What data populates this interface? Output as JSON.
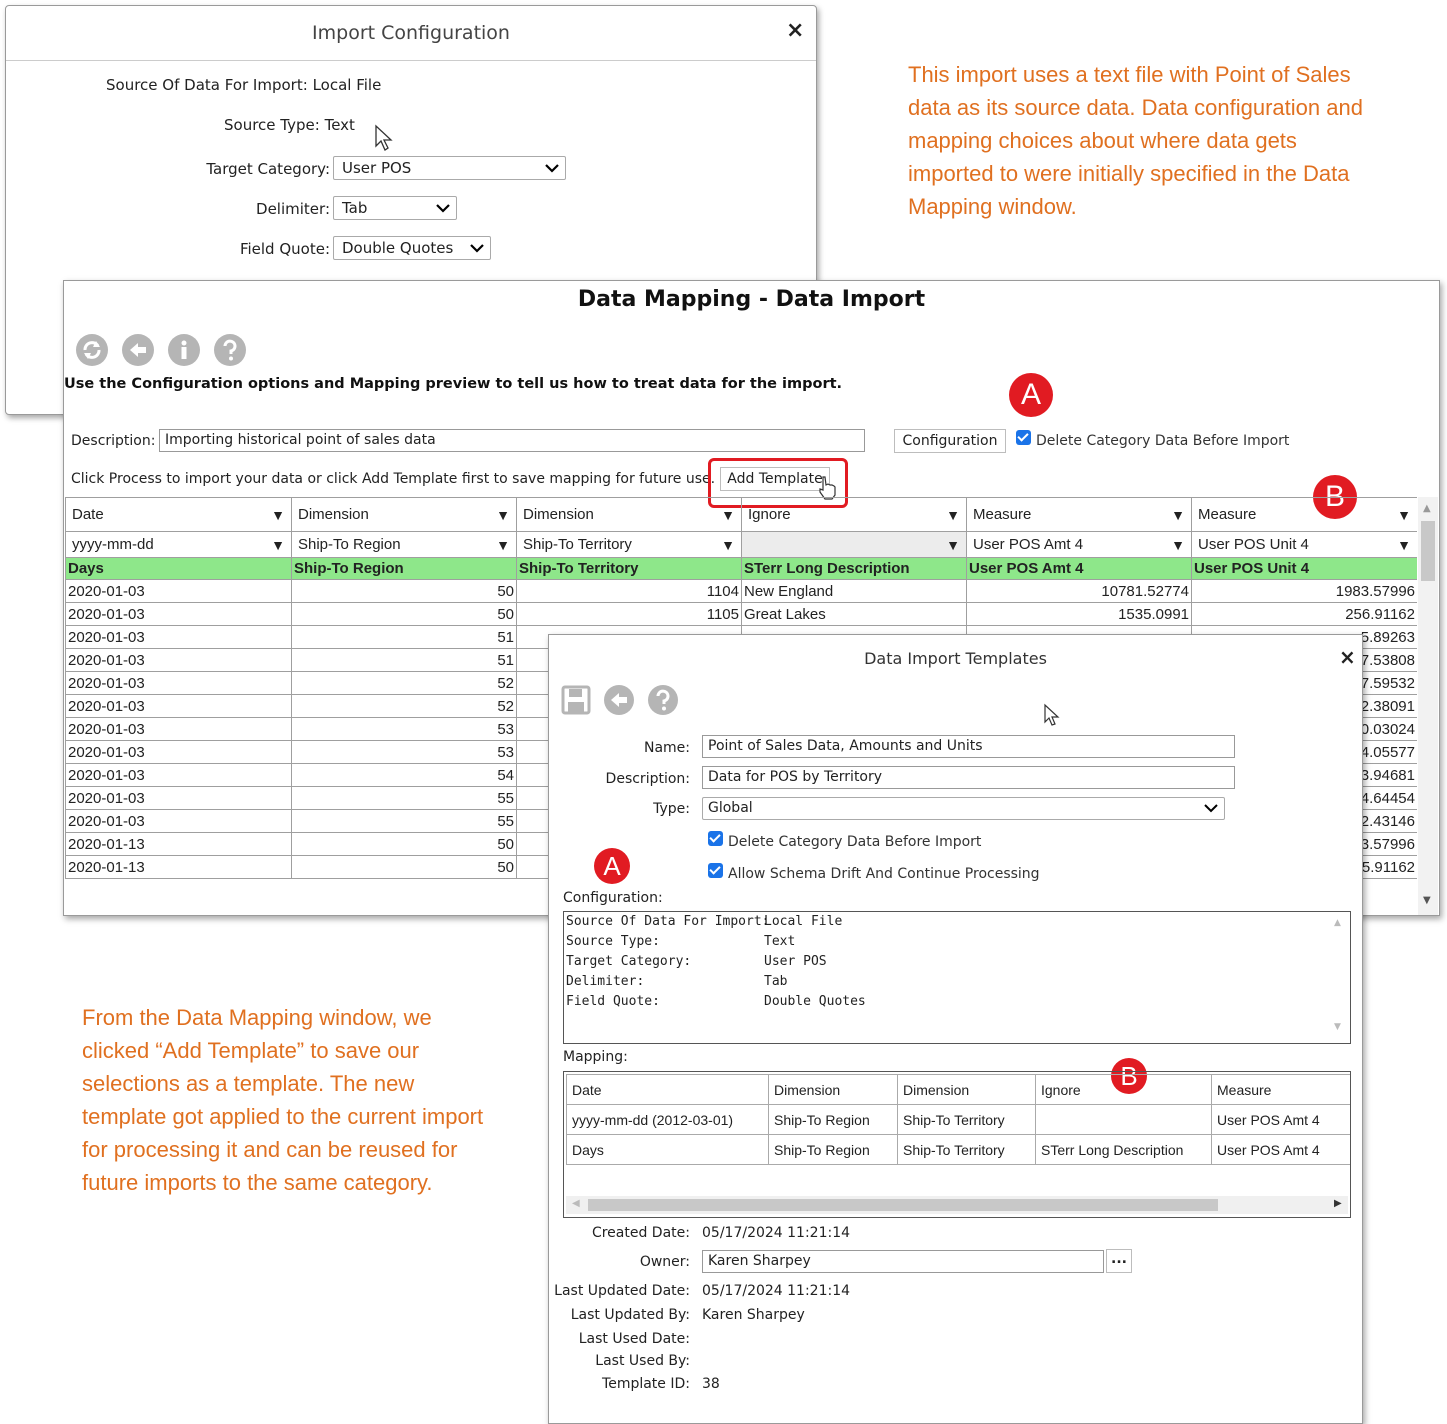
{
  "import_config": {
    "title": "Import Configuration",
    "close": "×",
    "source_label": "Source Of Data For Import:",
    "source_value": "Local File",
    "source_type_label": "Source Type:",
    "source_type_value": "Text",
    "target_category_label": "Target Category:",
    "target_category_value": "User POS",
    "delimiter_label": "Delimiter:",
    "delimiter_value": "Tab",
    "field_quote_label": "Field Quote:",
    "field_quote_value": "Double Quotes"
  },
  "notes": {
    "top_right": "This import uses a text file with Point of Sales data as its source data. Data configuration and mapping choices about where data gets imported to were initially specified in the Data Mapping window.",
    "bottom_left": "From the Data Mapping window, we clicked “Add Template” to save our selections as a template. The new template got applied to the current import for processing it and can be reused for future imports to the same category."
  },
  "badges": {
    "a": "A",
    "b": "B"
  },
  "data_mapping": {
    "title": "Data Mapping - Data Import",
    "instruction": "Use the Configuration options and Mapping preview to tell us how to treat data for the import.",
    "description_label": "Description:",
    "description_value": "Importing historical point of sales data",
    "configuration_button": "Configuration",
    "delete_category_label": "Delete Category Data Before Import",
    "process_hint": "Click Process to import your data or click Add Template first to save mapping for future use.",
    "add_template_button": "Add Template",
    "columns": [
      {
        "type": "Date",
        "format": "yyyy-mm-dd",
        "header": "Days"
      },
      {
        "type": "Dimension",
        "format": "Ship-To Region",
        "header": "Ship-To Region"
      },
      {
        "type": "Dimension",
        "format": "Ship-To Territory",
        "header": "Ship-To Territory"
      },
      {
        "type": "Ignore",
        "format": "",
        "header": "STerr Long Description"
      },
      {
        "type": "Measure",
        "format": "User POS Amt 4",
        "header": "User POS Amt 4"
      },
      {
        "type": "Measure",
        "format": "User POS Unit 4",
        "header": "User POS Unit 4"
      }
    ],
    "rows": [
      [
        "2020-01-03",
        "50",
        "1104",
        "New England",
        "10781.52774",
        "1983.57996"
      ],
      [
        "2020-01-03",
        "50",
        "1105",
        "Great Lakes",
        "1535.0991",
        "256.91162"
      ],
      [
        "2020-01-03",
        "51",
        "",
        "",
        "",
        "5.89263"
      ],
      [
        "2020-01-03",
        "51",
        "",
        "",
        "",
        "7.53808"
      ],
      [
        "2020-01-03",
        "52",
        "",
        "",
        "",
        "7.59532"
      ],
      [
        "2020-01-03",
        "52",
        "",
        "",
        "",
        "2.38091"
      ],
      [
        "2020-01-03",
        "53",
        "",
        "",
        "",
        "0.03024"
      ],
      [
        "2020-01-03",
        "53",
        "",
        "",
        "",
        "4.05577"
      ],
      [
        "2020-01-03",
        "54",
        "",
        "",
        "",
        "3.94681"
      ],
      [
        "2020-01-03",
        "55",
        "",
        "",
        "",
        "4.64454"
      ],
      [
        "2020-01-03",
        "55",
        "",
        "",
        "",
        "2.43146"
      ],
      [
        "2020-01-13",
        "50",
        "",
        "",
        "",
        "3.57996"
      ],
      [
        "2020-01-13",
        "50",
        "",
        "",
        "",
        "5.91162"
      ]
    ]
  },
  "templates": {
    "title": "Data Import Templates",
    "close": "×",
    "name_label": "Name:",
    "name_value": "Point of Sales Data, Amounts and Units",
    "description_label": "Description:",
    "description_value": "Data for POS by Territory",
    "type_label": "Type:",
    "type_value": "Global",
    "delete_category_label": "Delete Category Data Before Import",
    "schema_drift_label": "Allow Schema Drift And Continue Processing",
    "configuration_label": "Configuration:",
    "config_lines": [
      {
        "key": "Source Of Data For Import:",
        "value": "Local File"
      },
      {
        "key": "Source Type:",
        "value": "Text"
      },
      {
        "key": "Target Category:",
        "value": "User POS"
      },
      {
        "key": "Delimiter:",
        "value": "Tab"
      },
      {
        "key": "Field Quote:",
        "value": "Double Quotes"
      }
    ],
    "mapping_label": "Mapping:",
    "mapping_rows": [
      [
        "Date",
        "Dimension",
        "Dimension",
        "Ignore",
        "Measure"
      ],
      [
        "yyyy-mm-dd (2012-03-01)",
        "Ship-To Region",
        "Ship-To Territory",
        "",
        "User POS Amt 4"
      ],
      [
        "Days",
        "Ship-To Region",
        "Ship-To Territory",
        "STerr Long Description",
        "User POS Amt 4"
      ]
    ],
    "created_date_label": "Created Date:",
    "created_date_value": "05/17/2024 11:21:14",
    "owner_label": "Owner:",
    "owner_value": "Karen Sharpey",
    "owner_button": "...",
    "last_updated_date_label": "Last Updated Date:",
    "last_updated_date_value": "05/17/2024 11:21:14",
    "last_updated_by_label": "Last Updated By:",
    "last_updated_by_value": "Karen Sharpey",
    "last_used_date_label": "Last Used Date:",
    "last_used_by_label": "Last Used By:",
    "template_id_label": "Template ID:",
    "template_id_value": "38"
  }
}
